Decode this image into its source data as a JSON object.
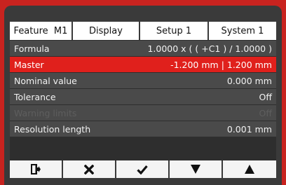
{
  "tabs": [
    {
      "label": "Feature  M1",
      "active": true
    },
    {
      "label": "Display",
      "active": false
    },
    {
      "label": "Setup 1",
      "active": false
    },
    {
      "label": "System 1",
      "active": false
    }
  ],
  "rows": [
    {
      "label": "Formula",
      "value": "1.0000 x ( ( +C1 ) / 1.0000 )"
    },
    {
      "label": "Master",
      "value": "-1.200 mm | 1.200 mm",
      "selected": true
    },
    {
      "label": "Nominal value",
      "value": "0.000 mm"
    },
    {
      "label": "Tolerance",
      "value": "Off"
    },
    {
      "label": "Warning limits",
      "value": "Off",
      "disabled": true
    },
    {
      "label": "Resolution length",
      "value": "0.001 mm"
    }
  ],
  "softkeys": [
    {
      "icon": "exit-icon"
    },
    {
      "icon": "cancel-icon"
    },
    {
      "icon": "confirm-icon"
    },
    {
      "icon": "arrow-down-icon"
    },
    {
      "icon": "arrow-up-icon"
    }
  ],
  "colors": {
    "frame": "#c8231f",
    "bezel": "#3a3a3a",
    "row": "#4a4a4a",
    "selected": "#e0201c",
    "disabled_text": "#5e5e5e"
  }
}
